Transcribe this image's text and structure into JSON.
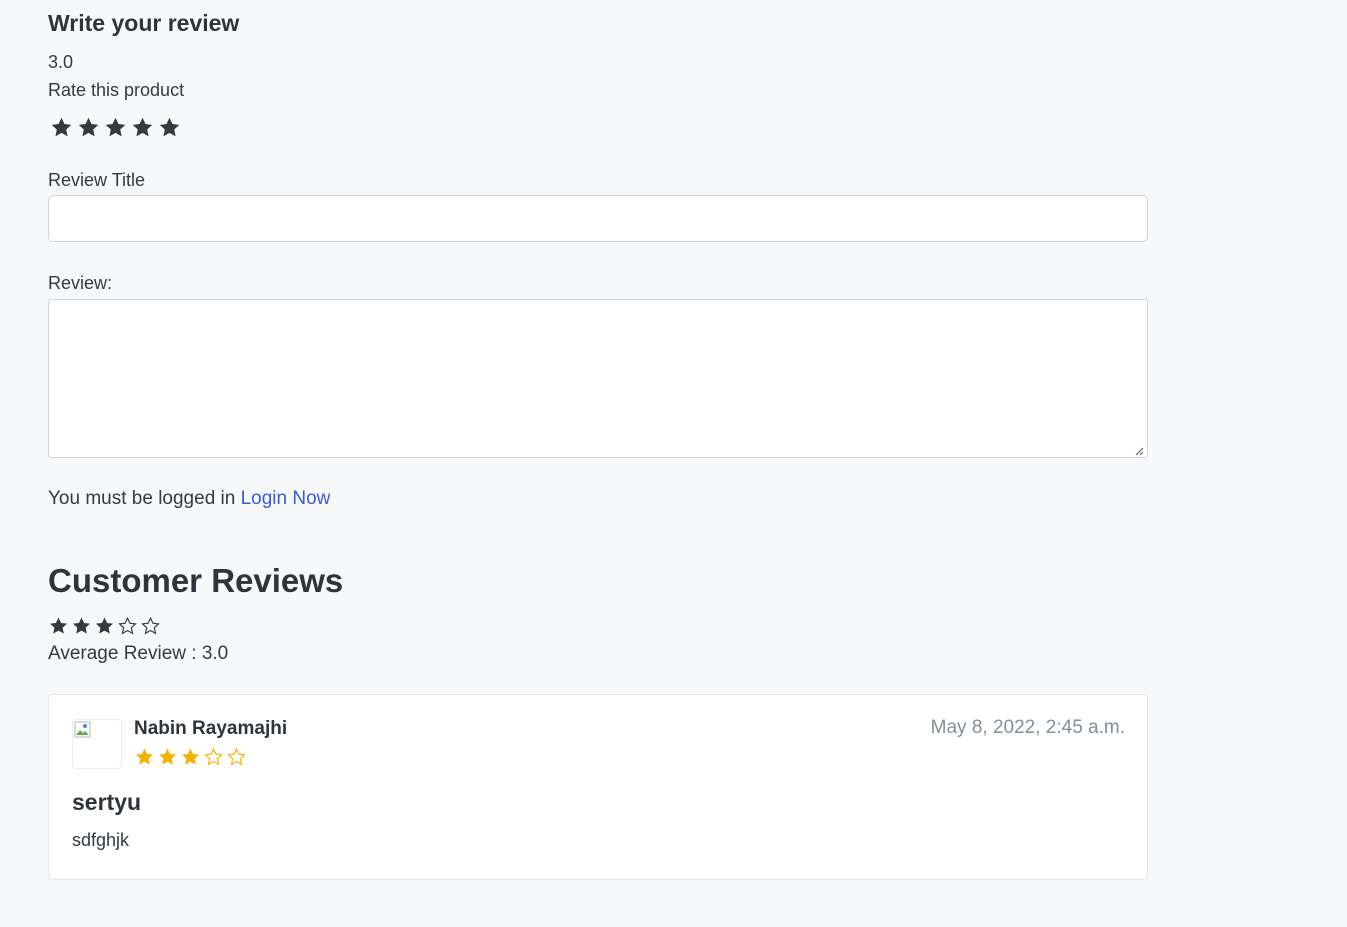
{
  "form": {
    "heading": "Write your review",
    "rating_value": "3.0",
    "rate_label": "Rate this product",
    "star_icon": "star-icon",
    "title_label": "Review Title",
    "title_value": "",
    "review_label": "Review:",
    "review_value": "",
    "login_text": "You must be logged in",
    "login_link": "Login Now"
  },
  "reviews": {
    "heading": "Customer Reviews",
    "average_label": "Average Review : 3.0",
    "average_rating": 3,
    "max_rating": 5,
    "items": [
      {
        "name": "Nabin Rayamajhi",
        "date": "May 8, 2022, 2:45 a.m.",
        "rating": 3,
        "title": "sertyu",
        "body": "sdfghjk"
      }
    ]
  },
  "colors": {
    "dark_star": "#343a40",
    "gold_star": "#f5b301",
    "link": "#3a5bd9"
  }
}
